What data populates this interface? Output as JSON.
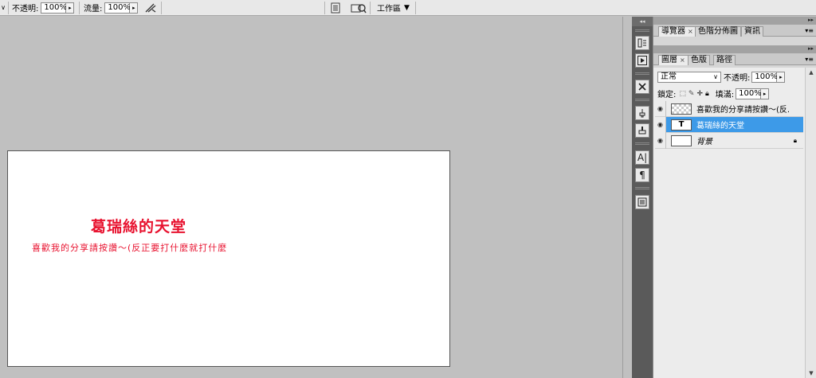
{
  "toolbar": {
    "opacity_label": "不透明:",
    "opacity_value": "100%",
    "flow_label": "流量:",
    "flow_value": "100%",
    "workspace_label": "工作區"
  },
  "document": {
    "title_text": "葛瑞絲的天堂",
    "subtitle_text": "喜歡我的分享請按讚～(反正要打什麼就打什麼"
  },
  "dock": {
    "collapse_glyph": "◂◂"
  },
  "panel_top": {
    "tabs": [
      "導覽器",
      "色階分佈圖",
      "資訊"
    ]
  },
  "layers_panel": {
    "tabs": [
      "圖層",
      "色版",
      "路徑"
    ],
    "blend_mode": "正常",
    "opacity_label": "不透明:",
    "opacity_value": "100%",
    "lock_label": "鎖定:",
    "fill_label": "填滿:",
    "fill_value": "100%",
    "layers": [
      {
        "name": "喜歡我的分享請按讚～(反...",
        "thumb": "checker"
      },
      {
        "name": "葛瑞絲的天堂",
        "thumb": "T"
      },
      {
        "name": "背景",
        "thumb": "white"
      }
    ]
  },
  "colors": {
    "text_red": "#e8122f",
    "selection_blue": "#3d9ae8"
  }
}
